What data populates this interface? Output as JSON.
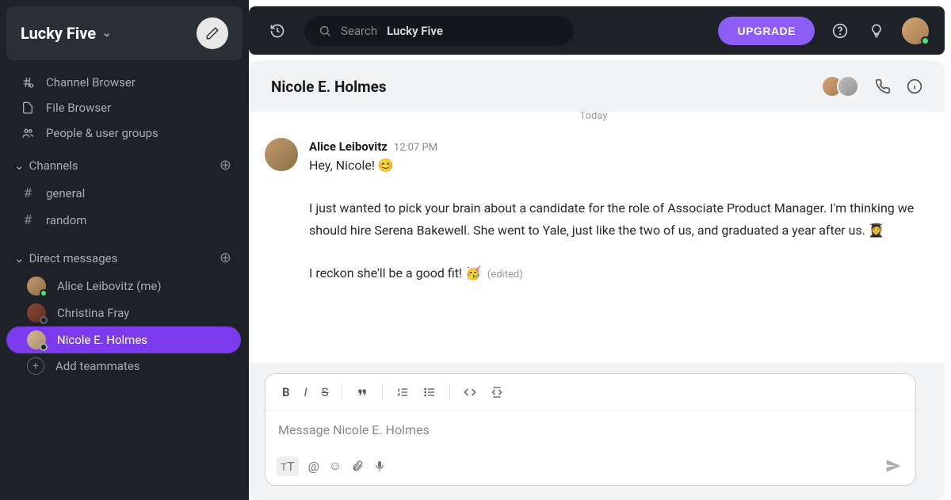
{
  "workspace": {
    "name": "Lucky Five"
  },
  "sidebar": {
    "browsers": [
      {
        "label": "Channel Browser",
        "icon": "hash-search"
      },
      {
        "label": "File Browser",
        "icon": "file"
      },
      {
        "label": "People & user groups",
        "icon": "people"
      }
    ],
    "channels_header": "Channels",
    "channels": [
      {
        "name": "general"
      },
      {
        "name": "random"
      }
    ],
    "dm_header": "Direct messages",
    "dms": [
      {
        "label": "Alice Leibovitz (me)",
        "status": "online",
        "active": false
      },
      {
        "label": "Christina Fray",
        "status": "offline",
        "active": false
      },
      {
        "label": "Nicole E. Holmes",
        "status": "offline",
        "active": true
      }
    ],
    "add_teammates": "Add teammates"
  },
  "topbar": {
    "search_label": "Search",
    "search_scope": "Lucky Five",
    "upgrade": "UPGRADE"
  },
  "chat": {
    "title": "Nicole E. Holmes",
    "date_divider": "Today",
    "message": {
      "author": "Alice Leibovitz",
      "time": "12:07 PM",
      "p1": "Hey, Nicole! 😊",
      "p2": "I just wanted to pick your brain about a candidate for the role of Associate Product Manager. I'm thinking we should hire Serena Bakewell. She went to Yale, just like the two of us, and graduated a year after us. 👩‍🎓",
      "p3": "I reckon she'll be a good fit! 🥳",
      "edited": "(edited)"
    },
    "composer_placeholder": "Message Nicole E. Holmes"
  }
}
